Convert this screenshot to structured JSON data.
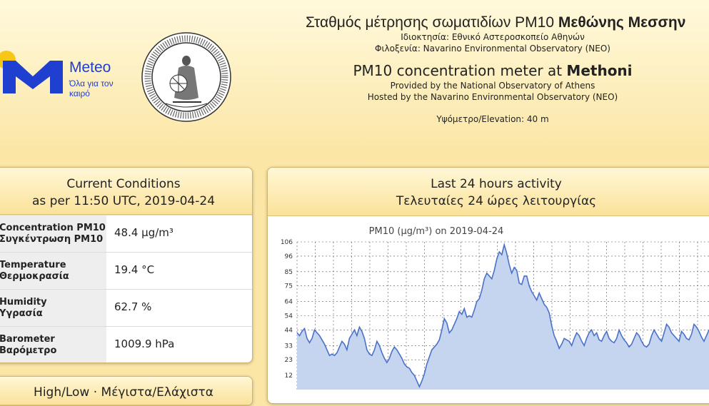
{
  "header": {
    "logo_brand": "Meteo",
    "logo_slogan": "Όλα για τον καιρό",
    "title_gr_prefix": "Σταθμός μέτρησης σωματιδίων PM10",
    "title_gr_bold": "Μεθώνης Μεσσην",
    "owner_gr": "Ιδιοκτησία: Εθνικό Αστεροσκοπείο Αθηνών",
    "host_gr": "Φιλοξενία: Navarino Environmental Observatory (NEO)",
    "title_en_prefix": "PM10 concentration meter at",
    "title_en_bold": "Methoni",
    "provided_en": "Provided by the National Observatory of Athens",
    "hosted_en": "Hosted by the Navarino Environmental Observatory (NEO)",
    "elevation": "Υψόμετρο/Elevation: 40 m",
    "colors": {
      "brand_blue": "#1e3fcf",
      "brand_yellow": "#f7c617"
    }
  },
  "current": {
    "title_line1": "Current Conditions",
    "title_line2": "as per 11:50 UTC, 2019-04-24",
    "rows": [
      {
        "label_en": "Concentration PM10",
        "label_gr": "Συγκέντρωση PM10",
        "value": "48.4 μg/m³"
      },
      {
        "label_en": "Temperature",
        "label_gr": "Θερμοκρασία",
        "value": "19.4 °C"
      },
      {
        "label_en": "Humidity",
        "label_gr": "Υγρασία",
        "value": "62.7 %"
      },
      {
        "label_en": "Barometer",
        "label_gr": "Βαρόμετρο",
        "value": "1009.9 hPa"
      }
    ]
  },
  "highlow": {
    "title": "High/Low · Μέγιστα/Ελάχιστα"
  },
  "activity": {
    "title_line1": "Last 24 hours activity",
    "title_line2": "Τελευταίες 24 ώρες λειτουργίας"
  },
  "chart_data": {
    "type": "area",
    "title": "PM10 (μg/m³) on 2019-04-24",
    "y_ticks": [
      106,
      96,
      85,
      75,
      64,
      54,
      44,
      33,
      23,
      12
    ],
    "ylim": [
      2,
      106
    ],
    "grid": true,
    "color": "#4a72c9",
    "fill": "#c5d4ef",
    "values": [
      42,
      40,
      43,
      45,
      38,
      35,
      38,
      44,
      42,
      40,
      37,
      34,
      30,
      26,
      27,
      26,
      28,
      32,
      36,
      34,
      30,
      38,
      41,
      44,
      40,
      46,
      43,
      38,
      30,
      27,
      26,
      30,
      36,
      33,
      28,
      24,
      21,
      24,
      29,
      32,
      30,
      27,
      24,
      20,
      18,
      17,
      14,
      12,
      8,
      4,
      8,
      13,
      20,
      25,
      30,
      32,
      34,
      37,
      44,
      52,
      49,
      42,
      44,
      48,
      52,
      57,
      55,
      59,
      53,
      54,
      53,
      58,
      64,
      66,
      72,
      80,
      84,
      82,
      80,
      86,
      94,
      99,
      97,
      104,
      98,
      90,
      84,
      88,
      86,
      77,
      76,
      82,
      82,
      75,
      71,
      68,
      65,
      70,
      66,
      62,
      60,
      56,
      47,
      40,
      36,
      31,
      34,
      38,
      37,
      36,
      33,
      38,
      42,
      40,
      36,
      33,
      38,
      42,
      44,
      40,
      42,
      37,
      36,
      40,
      43,
      38,
      36,
      35,
      38,
      44,
      40,
      37,
      35,
      32,
      34,
      38,
      42,
      40,
      36,
      33,
      32,
      34,
      40,
      44,
      41,
      38,
      36,
      42,
      48,
      46,
      42,
      40,
      38,
      36,
      43,
      41,
      38,
      37,
      41,
      48,
      46,
      43,
      39,
      36,
      40,
      44
    ]
  }
}
